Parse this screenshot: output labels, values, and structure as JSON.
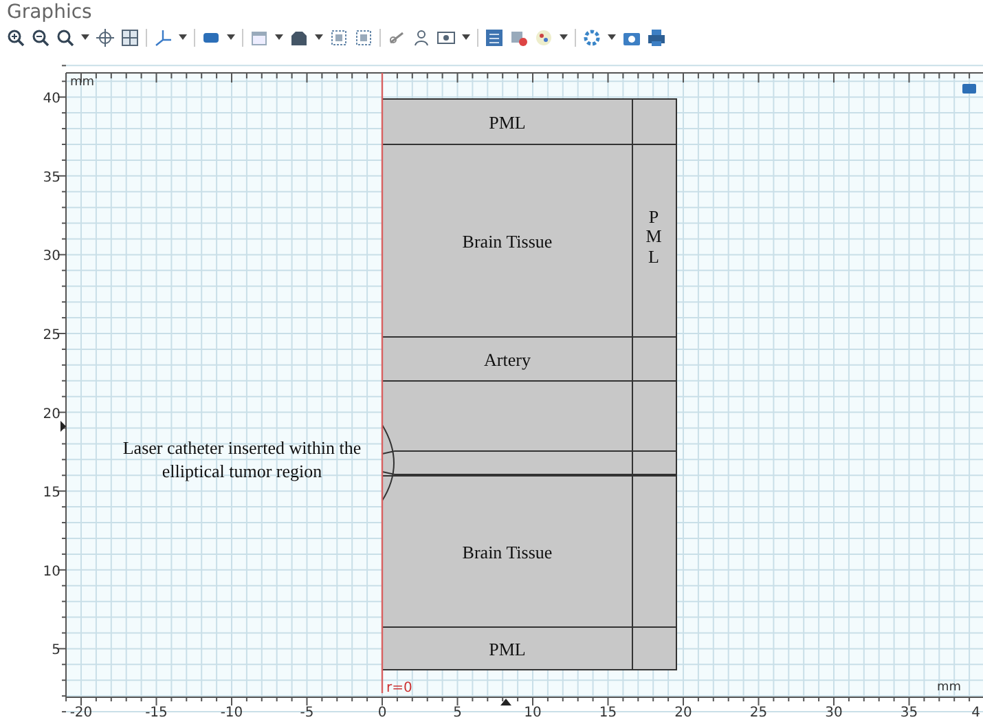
{
  "window": {
    "title": "Graphics"
  },
  "axes": {
    "x_unit": "mm",
    "y_unit": "mm",
    "origin_label": "r=0",
    "xticks": [
      "-20",
      "-15",
      "-10",
      "-5",
      "0",
      "5",
      "10",
      "15",
      "20",
      "25",
      "30",
      "35",
      "4"
    ],
    "yticks": [
      "40",
      "35",
      "30",
      "25",
      "20",
      "15",
      "10",
      "5"
    ]
  },
  "regions": [
    {
      "label": "PML"
    },
    {
      "label": "Brain Tissue"
    },
    {
      "label": "Artery"
    },
    {
      "label": "Brain Tissue"
    },
    {
      "label": "PML"
    }
  ],
  "side_region": {
    "label": "PML"
  },
  "annotation": "Laser catheter inserted within the elliptical tumor region"
}
